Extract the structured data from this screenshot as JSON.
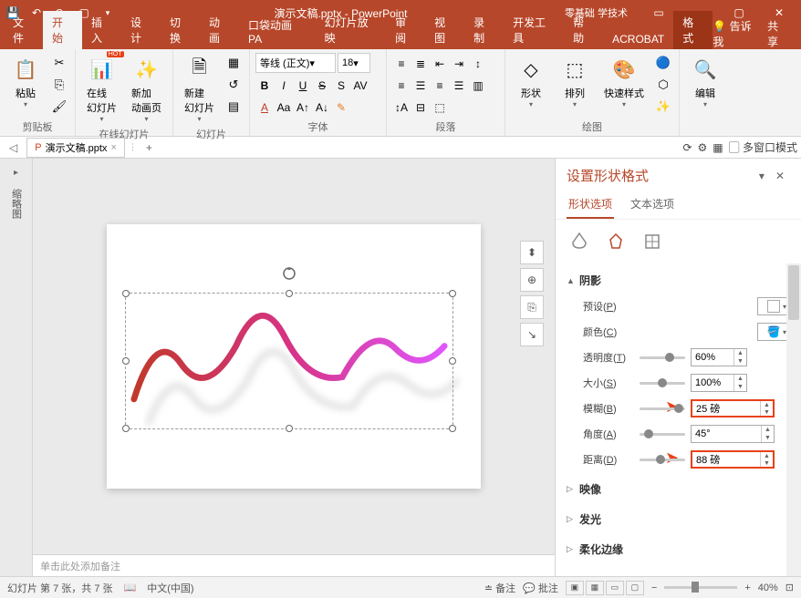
{
  "titlebar": {
    "title": "演示文稿.pptx - PowerPoint",
    "branding": "零基础 学技术"
  },
  "ribbon_tabs": {
    "file": "文件",
    "home": "开始",
    "insert": "插入",
    "design": "设计",
    "transitions": "切换",
    "animations": "动画",
    "pocket_anim": "口袋动画 PA",
    "slideshow": "幻灯片放映",
    "review": "审阅",
    "view": "视图",
    "record": "录制",
    "developer": "开发工具",
    "help": "帮助",
    "acrobat": "ACROBAT",
    "format": "格式",
    "tellme": "告诉我",
    "share": "共享"
  },
  "ribbon": {
    "clipboard": {
      "paste": "粘贴",
      "label": "剪贴板"
    },
    "online_slides": {
      "online": "在线\n幻灯片",
      "newanim": "新加\n动画页",
      "label": "在线幻灯片"
    },
    "slides": {
      "newslide": "新建\n幻灯片",
      "label": "幻灯片"
    },
    "font": {
      "name": "等线 (正文)",
      "size": "18",
      "label": "字体"
    },
    "paragraph": {
      "label": "段落"
    },
    "drawing": {
      "shapes": "形状",
      "arrange": "排列",
      "quickstyles": "快速样式",
      "label": "绘图"
    },
    "editing": {
      "label": "编辑"
    }
  },
  "subbar": {
    "filename": "演示文稿.pptx",
    "multiwin": "多窗口模式"
  },
  "thumb_rail": {
    "label": "缩略图"
  },
  "notes": {
    "placeholder": "单击此处添加备注"
  },
  "format_pane": {
    "title": "设置形状格式",
    "tab_shape": "形状选项",
    "tab_text": "文本选项",
    "sections": {
      "shadow": "阴影",
      "reflection": "映像",
      "glow": "发光",
      "soft_edges": "柔化边缘"
    },
    "shadow": {
      "preset_label": "预设",
      "preset_key": "P",
      "color_label": "颜色",
      "color_key": "C",
      "transparency_label": "透明度",
      "transparency_key": "T",
      "transparency_value": "60%",
      "size_label": "大小",
      "size_key": "S",
      "size_value": "100%",
      "blur_label": "模糊",
      "blur_key": "B",
      "blur_value": "25 磅",
      "angle_label": "角度",
      "angle_key": "A",
      "angle_value": "45°",
      "distance_label": "距离",
      "distance_key": "D",
      "distance_value": "88 磅"
    }
  },
  "statusbar": {
    "slide_info": "幻灯片 第 7 张，共 7 张",
    "language": "中文(中国)",
    "notes_btn": "备注",
    "comments_btn": "批注",
    "zoom": "40%"
  }
}
